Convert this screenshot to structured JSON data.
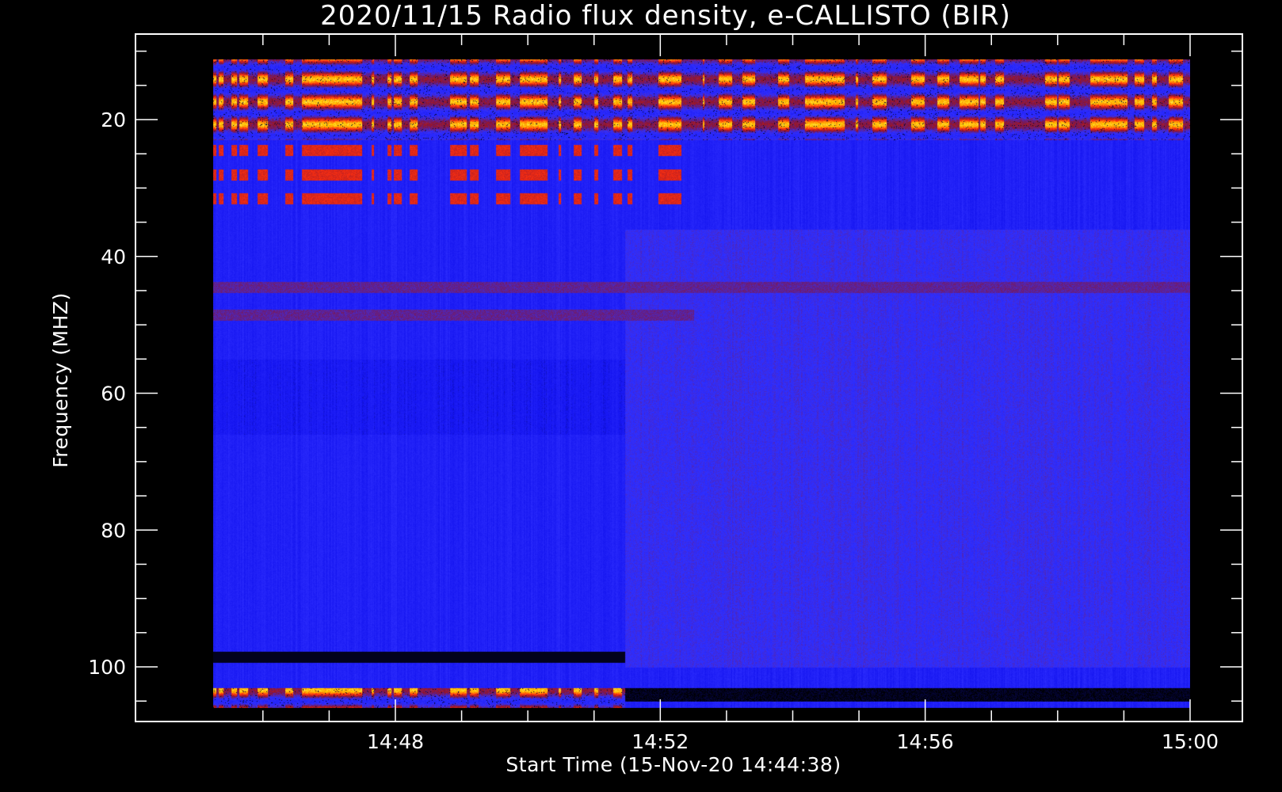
{
  "chart_data": {
    "type": "heatmap",
    "title": "2020/11/15  Radio flux density, e-CALLISTO (BIR)",
    "xlabel": "Start Time (15-Nov-20 14:44:38)",
    "ylabel": "Frequency (MHZ)",
    "x_axis": {
      "unit": "time (HH:MM)",
      "ticks": [
        "14:48",
        "14:52",
        "14:56",
        "15:00"
      ],
      "data_start": "14:45:15",
      "data_end": "15:00:00"
    },
    "y_axis": {
      "unit": "MHz",
      "inverted": true,
      "range": [
        10,
        106
      ],
      "ticks": [
        20,
        40,
        60,
        80,
        100
      ],
      "minor_step": 5
    },
    "instrument_changeover_time": "14:51:28",
    "colormap": {
      "name": "blue-red-yellow",
      "stops": [
        "#000000",
        "#1414f0",
        "#3030ff",
        "#8a1430",
        "#ff3010",
        "#ffd000",
        "#ffffff"
      ]
    },
    "features": [
      {
        "kind": "strong-emission-band",
        "freq_range": [
          10,
          23
        ],
        "time_range": [
          "14:45:15",
          "15:00:00"
        ],
        "level": "high"
      },
      {
        "kind": "emission-line",
        "freq": 24.5,
        "time_range": [
          "14:45:15",
          "14:52:30"
        ],
        "level": "medium"
      },
      {
        "kind": "emission-line",
        "freq": 28,
        "time_range": [
          "14:45:15",
          "14:52:30"
        ],
        "level": "medium"
      },
      {
        "kind": "emission-line",
        "freq": 31.5,
        "time_range": [
          "14:45:15",
          "14:52:30"
        ],
        "level": "medium"
      },
      {
        "kind": "faint-line",
        "freq": 48.5,
        "time_range": [
          "14:45:15",
          "14:52:30"
        ],
        "level": "low"
      },
      {
        "kind": "faint-line",
        "freq": 44.5,
        "time_range": [
          "14:45:15",
          "15:00:00"
        ],
        "level": "low"
      },
      {
        "kind": "dark-band",
        "freq": 98.5,
        "time_range": [
          "14:45:15",
          "14:51:28"
        ],
        "level": "very-low"
      },
      {
        "kind": "emission-band",
        "freq_range": [
          103,
          106
        ],
        "time_range": [
          "14:45:15",
          "14:51:28"
        ],
        "level": "high"
      },
      {
        "kind": "dark-band",
        "freq_range": [
          103,
          105
        ],
        "time_range": [
          "14:51:28",
          "15:00:00"
        ],
        "level": "very-low"
      }
    ]
  }
}
